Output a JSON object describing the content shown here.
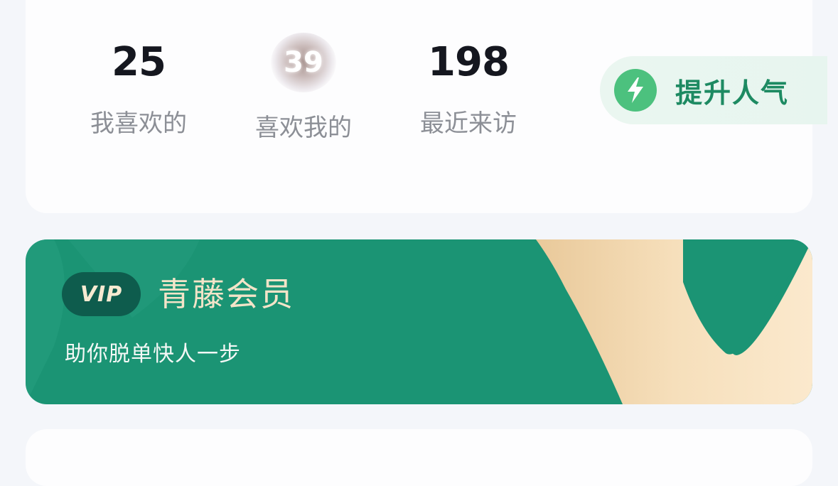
{
  "stats": {
    "likes": {
      "value": "25",
      "label": "我喜欢的"
    },
    "liked_me": {
      "value": "39",
      "label": "喜欢我的"
    },
    "visitors": {
      "value": "198",
      "label": "最近来访"
    }
  },
  "boost": {
    "label": "提升人气",
    "icon": "lightning-bolt-icon",
    "accent": "#4cc17e",
    "text_color": "#1d8a62"
  },
  "vip": {
    "badge": "VIP",
    "title": "青藤会员",
    "subtitle": "助你脱单快人一步",
    "background": "#1b9474",
    "accent": "#f3e4c8"
  }
}
